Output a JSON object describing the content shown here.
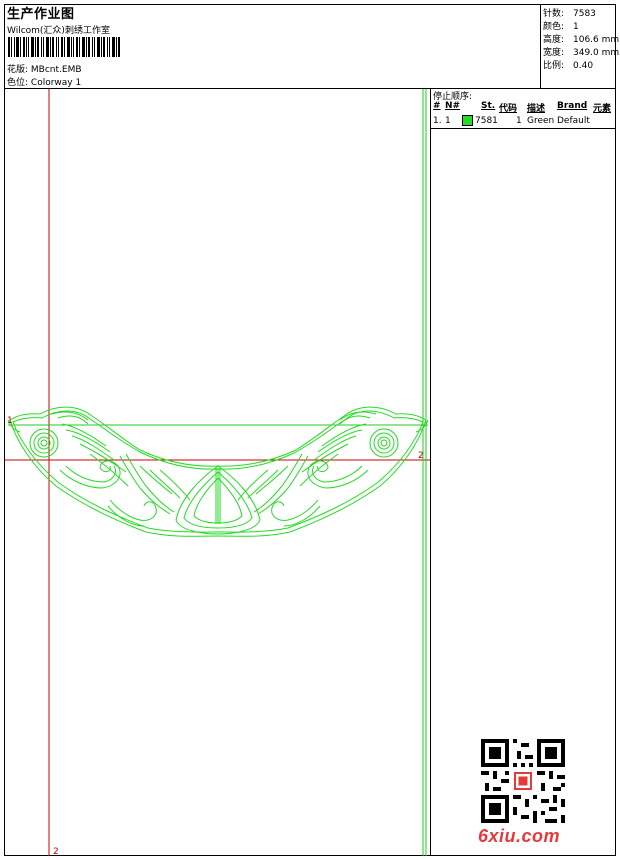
{
  "header": {
    "title": "生产作业图",
    "company": "Wilcom(汇众)刺绣工作室",
    "design_label": "花版:",
    "design_value": "MBcnt.EMB",
    "colorway_label": "色位:",
    "colorway_value": "Colorway 1"
  },
  "meta": {
    "stitches_label": "针数:",
    "stitches_value": "7583",
    "colors_label": "颜色:",
    "colors_value": "1",
    "height_label": "高度:",
    "height_value": "106.6 mm",
    "width_label": "宽度:",
    "width_value": "349.0 mm",
    "scale_label": "比例:",
    "scale_value": "0.40"
  },
  "stop_sequence": {
    "title": "停止顺序:",
    "columns": [
      "#",
      "N#",
      "St.",
      "代码",
      "描述",
      "Brand",
      "元素"
    ],
    "rows": [
      {
        "index": "1.",
        "needle": "1",
        "color": "#22dd22",
        "stitches": "7581",
        "code": "1",
        "description": "Green",
        "brand": "Default"
      }
    ]
  },
  "rulers": {
    "left_marker": "1",
    "right_marker": "2",
    "bottom_marker": "2"
  },
  "colors": {
    "thread": "#22dd22",
    "guide_red": "#d00000",
    "guide_green": "#22cc22",
    "logo": "#e63a3a"
  },
  "watermark": {
    "site": "6xiu.com"
  }
}
